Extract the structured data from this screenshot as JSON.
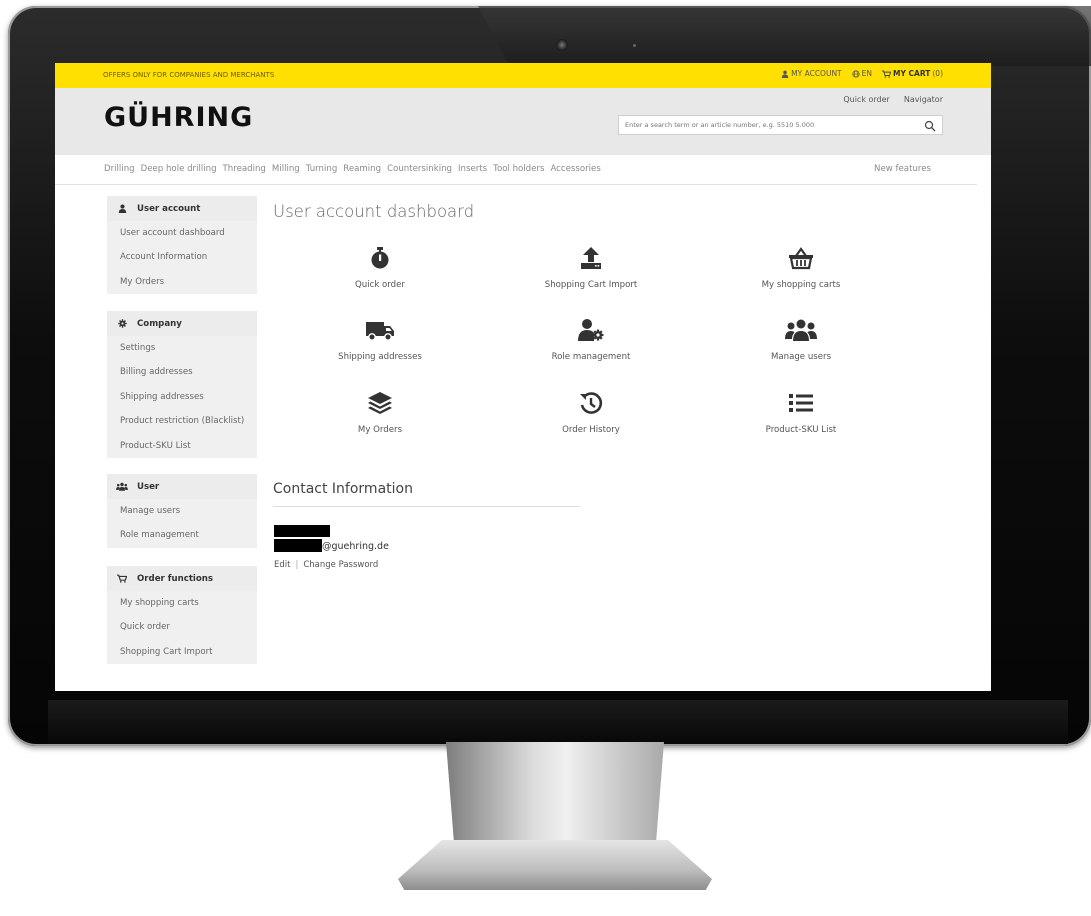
{
  "topbar": {
    "offers": "OFFERS ONLY FOR COMPANIES AND MERCHANTS",
    "my_account": "MY ACCOUNT",
    "language": "EN",
    "cart_label": "MY CART",
    "cart_count": "(0)"
  },
  "header": {
    "logo": "GÜHRING",
    "quick_order": "Quick order",
    "navigator": "Navigator",
    "search_placeholder": "Enter a search term or an article number, e.g. 5510 5.000"
  },
  "nav": {
    "items": [
      "Drilling",
      "Deep hole drilling",
      "Threading",
      "Milling",
      "Turning",
      "Reaming",
      "Countersinking",
      "Inserts",
      "Tool holders",
      "Accessories"
    ],
    "new_features": "New features"
  },
  "sidebar": {
    "groups": [
      {
        "title": "User account",
        "icon": "user-icon",
        "items": [
          "User account dashboard",
          "Account Information",
          "My Orders"
        ]
      },
      {
        "title": "Company",
        "icon": "gear-icon",
        "items": [
          "Settings",
          "Billing addresses",
          "Shipping addresses",
          "Product restriction (Blacklist)",
          "Product-SKU List"
        ]
      },
      {
        "title": "User",
        "icon": "users-icon",
        "items": [
          "Manage users",
          "Role management"
        ]
      },
      {
        "title": "Order functions",
        "icon": "cart-icon",
        "items": [
          "My shopping carts",
          "Quick order",
          "Shopping Cart Import"
        ]
      }
    ]
  },
  "main": {
    "title": "User account dashboard",
    "tiles": [
      {
        "label": "Quick order",
        "icon": "stopwatch-icon"
      },
      {
        "label": "Shopping Cart Import",
        "icon": "upload-icon"
      },
      {
        "label": "My shopping carts",
        "icon": "basket-icon"
      },
      {
        "label": "Shipping addresses",
        "icon": "truck-icon"
      },
      {
        "label": "Role management",
        "icon": "user-gear-icon"
      },
      {
        "label": "Manage users",
        "icon": "users-icon"
      },
      {
        "label": "My Orders",
        "icon": "layers-icon"
      },
      {
        "label": "Order History",
        "icon": "history-icon"
      },
      {
        "label": "Product-SKU List",
        "icon": "list-icon"
      }
    ]
  },
  "contact": {
    "title": "Contact Information",
    "email_suffix": "@guehring.de",
    "edit": "Edit",
    "separator": "|",
    "change_password": "Change Password"
  },
  "colors": {
    "accent": "#ffe000",
    "header_bg": "#e8e8e8",
    "sidebar_bg": "#ececec"
  }
}
